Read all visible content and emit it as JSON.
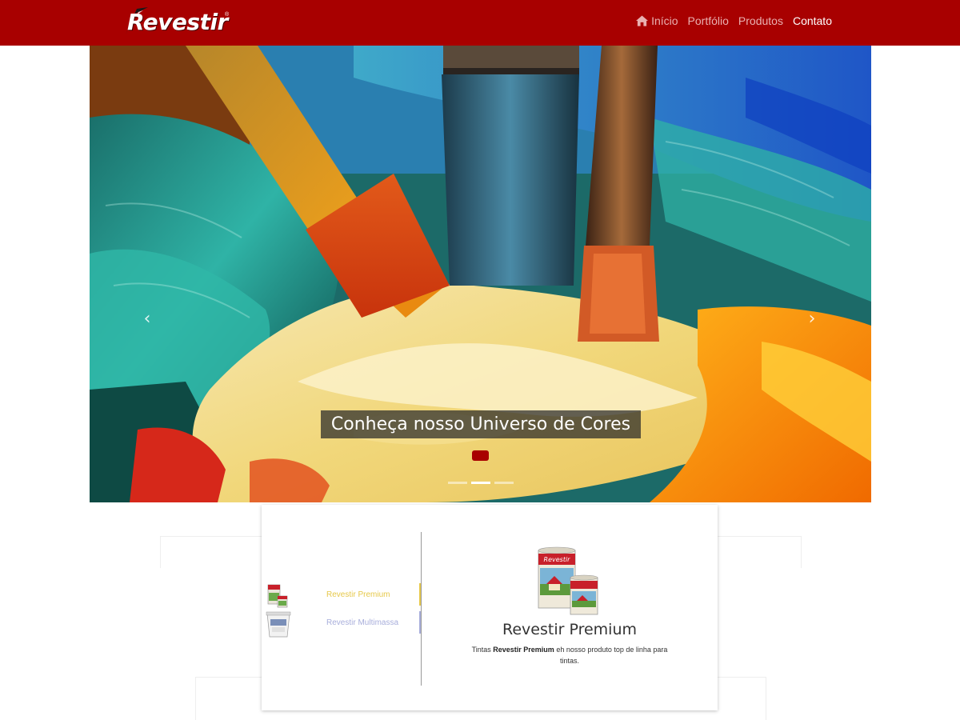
{
  "brand": {
    "name": "Revestir",
    "reg": "®"
  },
  "nav": {
    "home": "Início",
    "portfolio": "Portfólio",
    "products": "Produtos",
    "contact": "Contato"
  },
  "hero": {
    "caption": "Conheça nosso Universo de Cores",
    "prev_glyph": "‹",
    "next_glyph": "›",
    "slides": 3,
    "active_slide": 2
  },
  "products": {
    "items": [
      {
        "name": "Revestir Premium",
        "color": "#e6c84a"
      },
      {
        "name": "Revestir Multimassa",
        "color": "#a8aedb"
      }
    ],
    "selected": {
      "title": "Revestir Premium",
      "desc_prefix": "Tintas",
      "desc_bold": "Revestir Premium",
      "desc_suffix": "eh nosso produto top de linha para tintas."
    }
  },
  "colors": {
    "brand_red": "#a80000",
    "accent_yellow": "#e6c84a",
    "accent_lilac": "#a8aedb"
  }
}
